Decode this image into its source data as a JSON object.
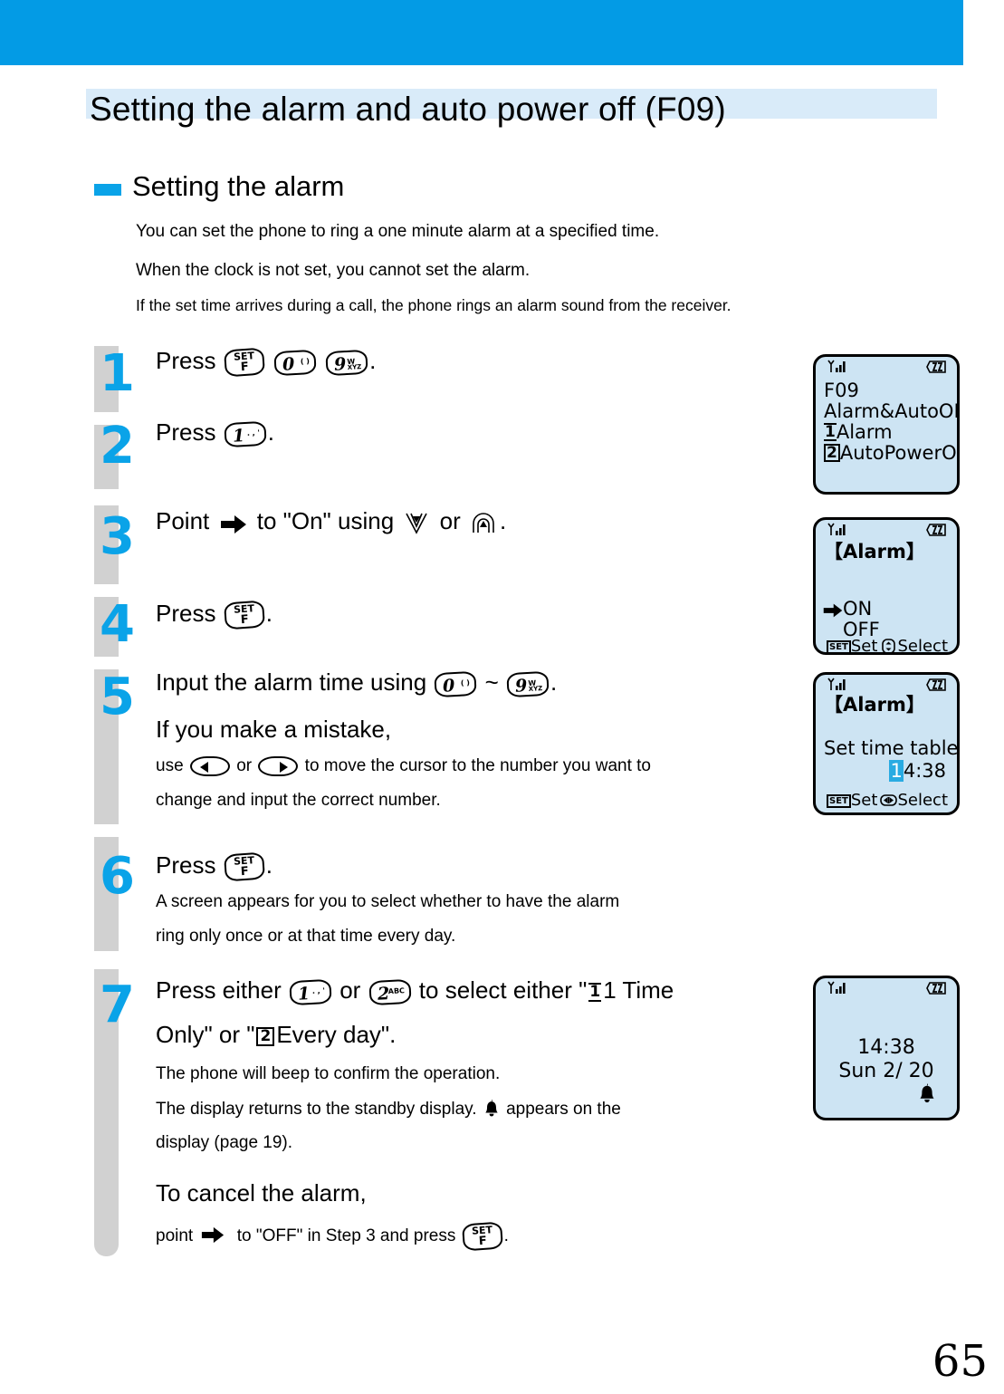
{
  "page": {
    "title": "Setting the alarm and auto power off (F09)",
    "number": "65"
  },
  "section": {
    "heading": "Setting the alarm",
    "intro": [
      "You can set the phone to ring a one minute alarm at a specified time.",
      "When the clock is not set, you cannot set the alarm.",
      "If the set time arrives during a call, the phone rings an alarm sound from the receiver."
    ]
  },
  "steps": [
    {
      "number": "1",
      "lead": "Press",
      "trail": "."
    },
    {
      "number": "2",
      "lead": "Press",
      "trail": "."
    },
    {
      "number": "3",
      "lead": "Point",
      "mid1": "to \"On\" using",
      "mid2": "or",
      "trail": "."
    },
    {
      "number": "4",
      "lead": "Press",
      "trail": "."
    },
    {
      "number": "5",
      "lead": "Input the alarm time using",
      "tilde": "~",
      "trail": ".",
      "note_line1": "If you make a mistake,",
      "note_line2_a": "use",
      "note_line2_b": "or",
      "note_line2_c": "to move the cursor to the number you want to",
      "note_line3": "change and input the correct number."
    },
    {
      "number": "6",
      "lead": "Press",
      "trail": ".",
      "note_line1": "A screen appears for you to select whether to have the alarm",
      "note_line2": "ring only once or at that time every day."
    },
    {
      "number": "7",
      "lead": "Press either",
      "mid_or": "or",
      "mid_sel": "to select either \"",
      "digit1": "1",
      "tail1": "1 Time",
      "line2_a": "Only\" or \"",
      "digit2": "2",
      "line2_b": "Every day\".",
      "note_line1": "The phone will beep to confirm the operation.",
      "note_line2_a": "The display returns to the standby display.",
      "note_line2_b": "appears on the",
      "note_line3": "display (page 19).",
      "cancel_line1": "To cancel the alarm,",
      "cancel_line2_a": "point",
      "cancel_line2_b": "to \"OFF\" in Step 3 and press",
      "cancel_line2_c": "."
    }
  ],
  "keys": {
    "setf": {
      "top": "SET",
      "bottom": "F"
    },
    "zero": {
      "digit": "0",
      "sub": "( )"
    },
    "one": {
      "digit": "1",
      "sub": ". , '"
    },
    "two": {
      "digit": "2",
      "sub": "ABC"
    },
    "nine": {
      "digit": "9",
      "sub_top": "W",
      "sub_bottom": "XYZ"
    },
    "left_soft": "left-arrow-key",
    "right_soft": "right-arrow-key"
  },
  "lcd_screens": [
    {
      "id": "f09-menu",
      "lines": [
        "F09",
        "Alarm&AutoOFF"
      ],
      "items": [
        {
          "tag": "1",
          "label": "Alarm"
        },
        {
          "tag": "2",
          "label": "AutoPowerOFF"
        }
      ]
    },
    {
      "id": "alarm-onoff",
      "title": "【Alarm】",
      "options": [
        "ON",
        "OFF"
      ],
      "selected": "ON",
      "soft_left": "Set",
      "soft_right": "Select"
    },
    {
      "id": "alarm-time",
      "title": "【Alarm】",
      "label": "Set time table",
      "time_cursor": "1",
      "time_rest": "4:38",
      "soft_left": "Set",
      "soft_right": "Select"
    },
    {
      "id": "standby",
      "time": "14:38",
      "date": "Sun 2/ 20",
      "alarm_icon": "bell-icon"
    }
  ],
  "colors": {
    "banner": "#039be5",
    "title_band": "#d9ebf9",
    "accent": "#0aa3e8",
    "rail": "#d1d1d1",
    "lcd": "#cde4f3",
    "highlight": "#29abe2"
  }
}
